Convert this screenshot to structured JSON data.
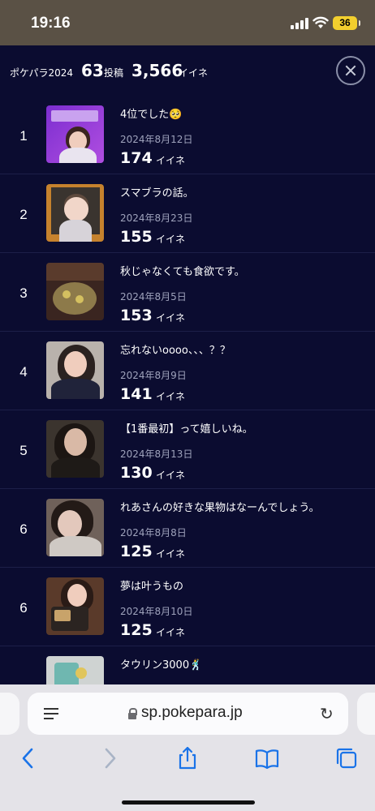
{
  "status_bar": {
    "time": "19:16",
    "battery": "36"
  },
  "header": {
    "brand": "ポケパラ2024",
    "posts_count": "63",
    "posts_label": "投稿",
    "likes_total": "3,566",
    "likes_label": "イイネ"
  },
  "posts": [
    {
      "rank": "1",
      "title": "4位でした🥺",
      "date": "2024年8月12日",
      "likes": "174",
      "likes_label": "イイネ"
    },
    {
      "rank": "2",
      "title": "スマブラの話。",
      "date": "2024年8月23日",
      "likes": "155",
      "likes_label": "イイネ"
    },
    {
      "rank": "3",
      "title": "秋じゃなくても食欲です。",
      "date": "2024年8月5日",
      "likes": "153",
      "likes_label": "イイネ"
    },
    {
      "rank": "4",
      "title": "忘れないoooo、、、？？",
      "date": "2024年8月9日",
      "likes": "141",
      "likes_label": "イイネ"
    },
    {
      "rank": "5",
      "title": "【1番最初】って嬉しいね。",
      "date": "2024年8月13日",
      "likes": "130",
      "likes_label": "イイネ"
    },
    {
      "rank": "6",
      "title": "れあさんの好きな果物はなーんでしょう。",
      "date": "2024年8月8日",
      "likes": "125",
      "likes_label": "イイネ"
    },
    {
      "rank": "6",
      "title": "夢は叶うもの",
      "date": "2024年8月10日",
      "likes": "125",
      "likes_label": "イイネ"
    },
    {
      "rank": "",
      "title": "タウリン3000🕺",
      "date": "",
      "likes": "",
      "likes_label": ""
    }
  ],
  "browser": {
    "url": "sp.pokepara.jp"
  },
  "colors": {
    "background": "#0b0c30",
    "accent_battery": "#f2cf2e",
    "safari_blue": "#1a73e8"
  }
}
